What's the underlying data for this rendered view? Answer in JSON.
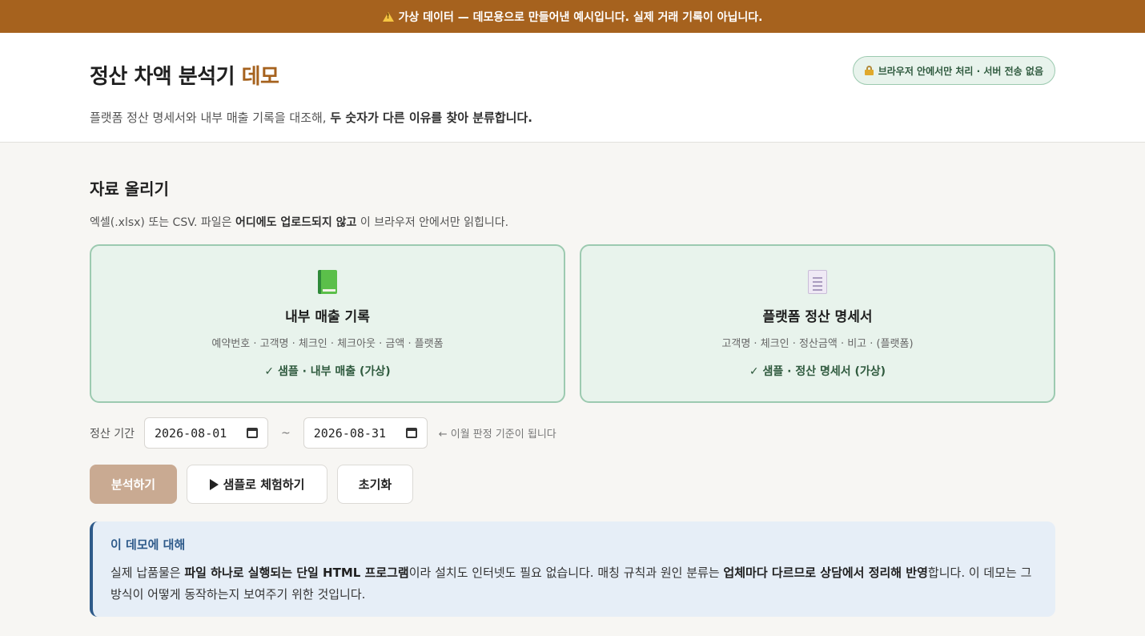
{
  "banner": {
    "icon": "warning-icon",
    "text": "가상 데이터 — 데모용으로 만들어낸 예시입니다. 실제 거래 기록이 아닙니다."
  },
  "header": {
    "title": "정산 차액 분석기",
    "title_accent": "데모",
    "subtitle_plain": "플랫폼 정산 명세서와 내부 매출 기록을 대조해, ",
    "subtitle_bold": "두 숫자가 다른 이유를 찾아 분류합니다.",
    "privacy_icon": "lock-icon",
    "privacy_badge": "브라우저 안에서만 처리 · 서버 전송 없음"
  },
  "upload": {
    "title": "자료 올리기",
    "desc_before": "엑셀(.xlsx) 또는 CSV. 파일은 ",
    "desc_bold": "어디에도 업로드되지 않고",
    "desc_after": " 이 브라우저 안에서만 읽힙니다.",
    "cards": [
      {
        "icon": "green-book-icon",
        "title": "내부 매출 기록",
        "fields": "예약번호 · 고객명 · 체크인 · 체크아웃 · 금액 · 플랫폼",
        "sample": "✓ 샘플 · 내부 매출 (가상)"
      },
      {
        "icon": "document-icon",
        "title": "플랫폼 정산 명세서",
        "fields": "고객명 · 체크인 · 정산금액 · 비고 · (플랫폼)",
        "sample": "✓ 샘플 · 정산 명세서 (가상)"
      }
    ]
  },
  "period": {
    "label": "정산 기간",
    "start": "2026-08-01",
    "separator": "~",
    "end": "2026-08-31",
    "hint": "← 이월 판정 기준이 됩니다"
  },
  "actions": {
    "analyze": "분석하기",
    "sample": "샘플로 체험하기",
    "reset": "초기화"
  },
  "info": {
    "title": "이 데모에 대해",
    "p1": "실제 납품물은 ",
    "b1": "파일 하나로 실행되는 단일 HTML 프로그램",
    "p2": "이라 설치도 인터넷도 필요 없습니다. 매칭 규칙과 원인 분류는 ",
    "b2": "업체마다 다르므로 상담에서 정리해 반영",
    "p3": "합니다. 이 데모는 그 방식이 어떻게 동작하는지 보여주기 위한 것입니다."
  },
  "colors": {
    "banner": "#a6621e",
    "accent": "#a6621e",
    "card_bg": "#e8f3ec",
    "card_border": "#9ccab0",
    "info_border": "#2e5a8a"
  }
}
